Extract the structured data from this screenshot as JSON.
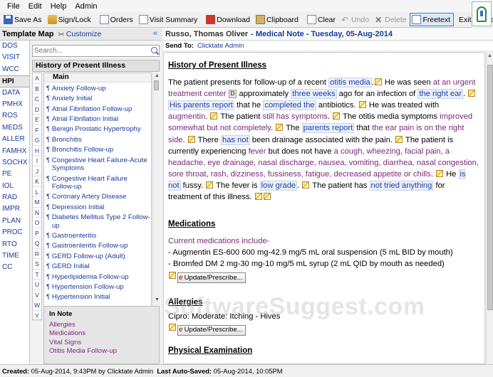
{
  "menu": [
    "File",
    "Edit",
    "Help",
    "Admin"
  ],
  "toolbar": {
    "save_as": "Save As",
    "sign_lock": "Sign/Lock",
    "orders": "Orders",
    "visit_summary": "Visit Summary",
    "download": "Download",
    "clipboard": "Clipboard",
    "clear": "Clear",
    "undo": "Undo",
    "delete": "Delete",
    "freetext": "Freetext",
    "exit": "Exit Console"
  },
  "template_map": {
    "title": "Template Map",
    "customize": "Customize",
    "collapse": "«",
    "search_placeholder": "Search...",
    "section": "History of Present Illness",
    "list_header": "Main",
    "items": [
      "Anxiety Follow-up",
      "Anxiety Initial",
      "Atrial Fibrillation Follow-up",
      "Atrial Fibrillation Initial",
      "Benign Prostatic Hypertrophy",
      "Bronchitis",
      "Bronchitis Follow-up",
      "Congestive Heart Failure-Acute Symptoms",
      "Congestive Heart Failure Follow-up",
      "Coronary Artery Disease",
      "Depression Initial",
      "Diabetes Mellitus Type 2 Follow-up",
      "Gastroenteritis",
      "Gastroenteritis Follow-up",
      "GERD Follow-up (Adult)",
      "GERD Initial",
      "Hyperlipidemia Follow-up",
      "Hypertension Follow-up",
      "Hypertension Initial"
    ],
    "alphabet": [
      "A",
      "B",
      "C",
      "D",
      "E",
      "F",
      "G",
      "H",
      "I",
      "J",
      "K",
      "L",
      "M",
      "N",
      "O",
      "P",
      "Q",
      "R",
      "S",
      "T",
      "U",
      "V",
      "W",
      "Y"
    ],
    "in_note_title": "In Note",
    "in_note": [
      "Allergies",
      "Medications",
      "Vital Signs",
      "Otitis Media Follow-up"
    ]
  },
  "left_tabs": [
    "DOS",
    "VISIT",
    "WCC",
    "HPI",
    "DATA",
    "PMHX",
    "ROS",
    "MEDS",
    "ALLER",
    "FAMHX",
    "SOCHX",
    "PE",
    "IOL",
    "RAD",
    "IMPR",
    "PLAN",
    "PROC",
    "RTO",
    "TIME",
    "CC"
  ],
  "active_tab": "HPI",
  "document": {
    "patient": "Russo, Thomas Oliver",
    "note": "- Medical Note - Tuesday, 05-Aug-2014",
    "send_to_label": "Send To:",
    "send_to": "Clicktate Admin",
    "hpi_title": "History of Present Illness",
    "meds_title": "Medications",
    "meds_intro": "Current medications include-",
    "med1": "- Augmentin ES-600 600 mg-42.9 mg/5 mL oral suspension (5 mL BID by mouth)",
    "med2": "- Bromfed DM 2 mg-30 mg-10 mg/5 mL syrup (2 mL QID by mouth as needed)",
    "update_btn": "Update/Prescribe...",
    "allergies_title": "Allergies",
    "allergy": "Cipro: Moderate: Itching - Hives",
    "pe_title": "Physical Examination"
  },
  "hpi": {
    "t1": "The patient presents for follow-up of a recent ",
    "b1": "otitis media",
    "t2": " He was seen ",
    "p1": "at an urgent treatment center",
    "d": "D",
    "t3": " approximately ",
    "b2": "three weeks",
    "t4": " ago for an infection of ",
    "b3": "the right ear",
    "t5": ".",
    "b4": "His parents report",
    "t6": " that he ",
    "b5": "completed the",
    "t7": " antibiotics. ",
    "t8": " He was treated with ",
    "p2": "augmentin",
    "t9": ". ",
    "t10": " The patient ",
    "p3": "still has symptoms",
    "t11": ". ",
    "t12": " The otitis media symptoms ",
    "p4": "improved somewhat but not completely",
    "t13": ". ",
    "t14": " The ",
    "b6": "parents report",
    "t15": " that ",
    "p5": "the ear pain is on the right side",
    "t16": ". ",
    "t17": " There ",
    "b7": "has not",
    "t18": " been drainage associated with the pain. ",
    "t19": " The patient is currently experiencing ",
    "p6": "fever",
    "t20": " but does not have ",
    "p7": "a cough, wheezing, facial pain, a headache, eye drainage, nasal discharge, nausea, vomiting, diarrhea, nasal congestion, sore throat, rash, dizziness, fussiness, fatigue, decreased appetite or chills",
    "t21": ". ",
    "t22": " He ",
    "b8": "is not",
    "t23": " fussy. ",
    "t24": " The fever is ",
    "b9": "low grade",
    "t25": ". ",
    "t26": " The patient has ",
    "b10": "not tried anything",
    "t27": " for treatment of this illness. "
  },
  "status": {
    "created_label": "Created:",
    "created": "05-Aug-2014, 9:43PM by Clicktate Admin",
    "autosaved_label": "Last Auto-Saved:",
    "autosaved": "05-Aug-2014, 10:05PM"
  },
  "watermark": "SoftwareSuggest.com"
}
